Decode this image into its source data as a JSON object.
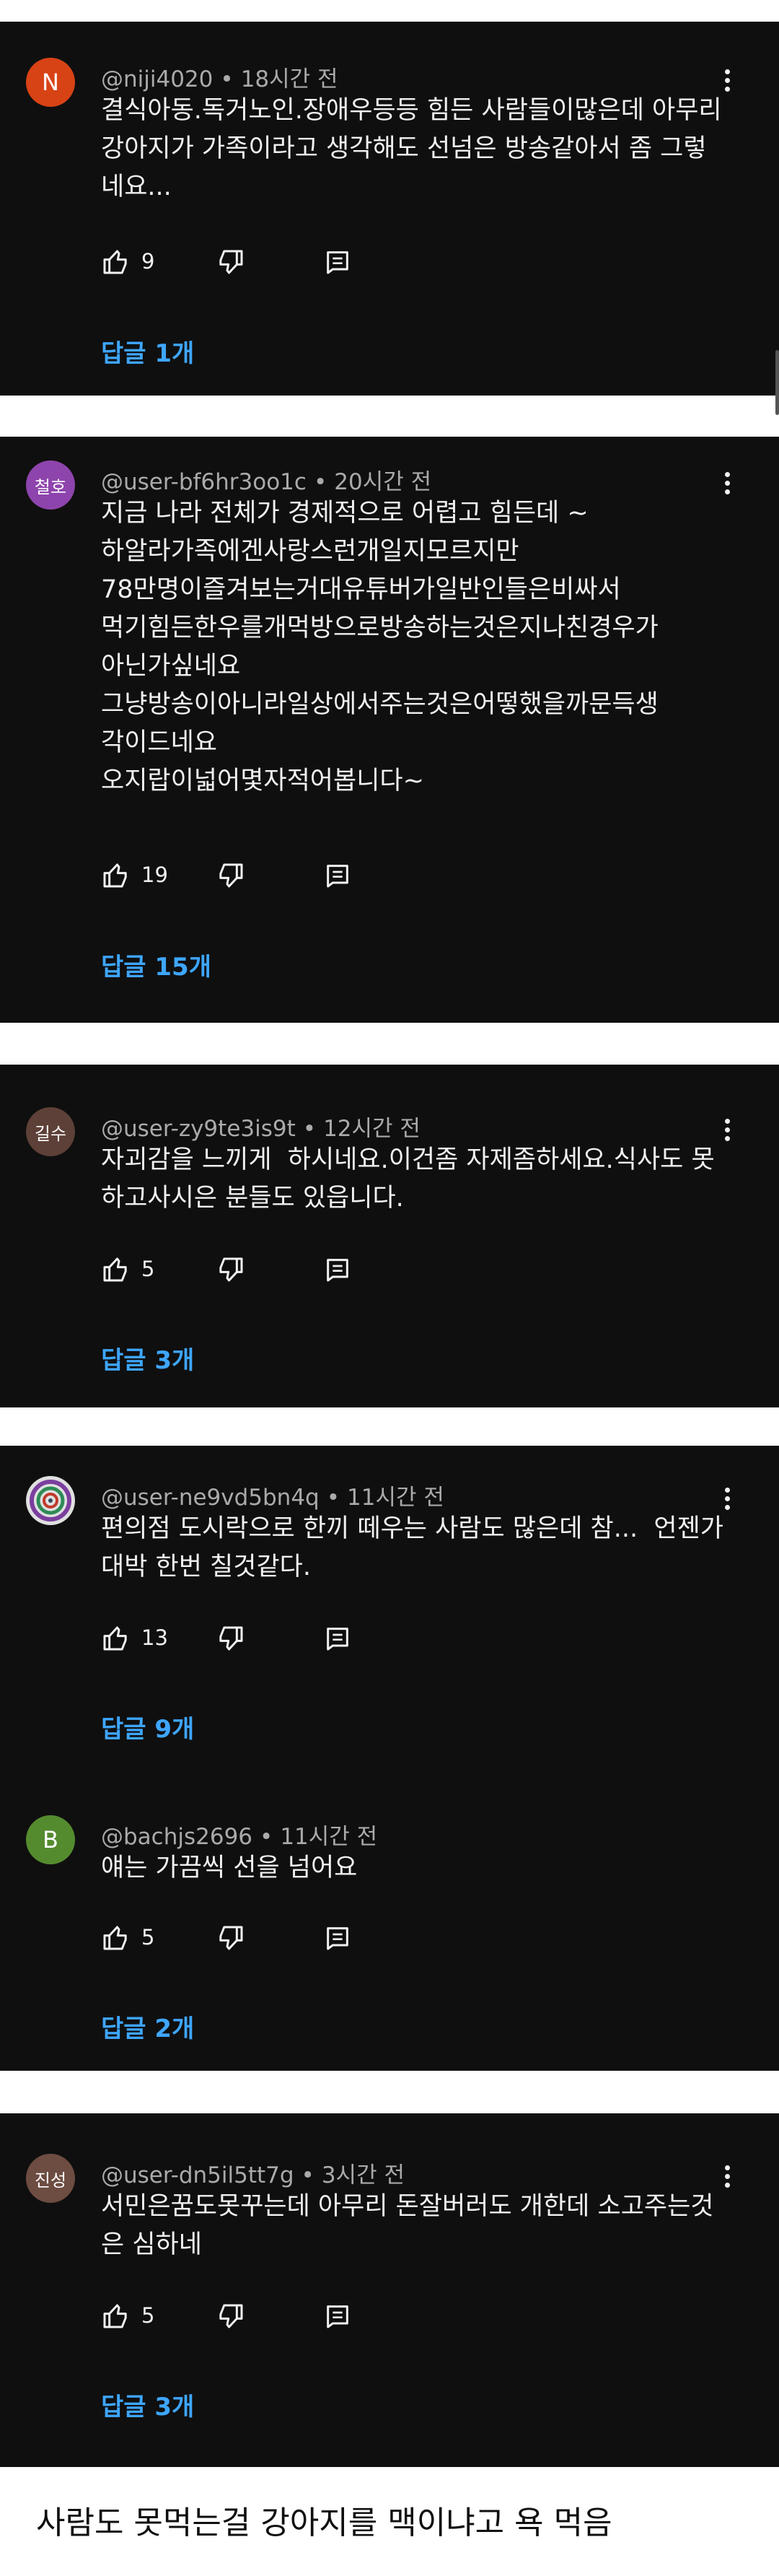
{
  "comments": [
    {
      "avatar_letter": "N",
      "avatar_color": "#d84315",
      "handle": "@niji4020",
      "time": "18시간 전",
      "text": "결식아동.독거노인.장애우등등 힘든 사람들이많은데 아무리 강아지가 가족이라고 생각해도 선넘은 방송같아서 좀 그렇네요...",
      "likes": "9",
      "replies": "답글 1개"
    },
    {
      "avatar_letter": "철호",
      "avatar_color": "#8e44ad",
      "handle": "@user-bf6hr3oo1c",
      "time": "20시간 전",
      "text": "지금 나라 전체가 경제적으로 어렵고 힘든데 ~\n하알라가족에겐사랑스런개일지모르지만\n78만명이즐겨보는거대유튜버가일반인들은비싸서\n먹기힘든한우를개먹방으로방송하는것은지나친경우가\n아닌가싶네요\n그냥방송이아니라일상에서주는것은어떻했을까문득생\n각이드네요\n오지랍이넓어몇자적어봅니다~",
      "likes": "19",
      "replies": "답글 15개"
    },
    {
      "avatar_letter": "길수",
      "avatar_color": "#5d4037",
      "handle": "@user-zy9te3is9t",
      "time": "12시간 전",
      "text": "자괴감을 느끼게  하시네요.이건좀 자제좀하세요.식사도 못하고사시은 분들도 있읍니다.",
      "likes": "5",
      "replies": "답글 3개"
    },
    {
      "avatar_letter": "",
      "avatar_color": "#e0e0e0",
      "handle": "@user-ne9vd5bn4q",
      "time": "11시간 전",
      "text": "편의점 도시락으로 한끼 떼우는 사람도 많은데 참...  언젠가 대박 한번 칠것같다.",
      "likes": "13",
      "replies": "답글 9개"
    },
    {
      "avatar_letter": "B",
      "avatar_color": "#558b2f",
      "handle": "@bachjs2696",
      "time": "11시간 전",
      "text": "얘는 가끔씩 선을 넘어요",
      "likes": "5",
      "replies": "답글 2개"
    },
    {
      "avatar_letter": "진성",
      "avatar_color": "#6d4c41",
      "handle": "@user-dn5il5tt7g",
      "time": "3시간 전",
      "text": "서민은꿈도못꾸는데 아무리 돈잘버러도 개한데 소고주는것은 심하네",
      "likes": "5",
      "replies": "답글 3개"
    }
  ],
  "separator": "•",
  "caption": "사람도 못먹는걸 강아지를 맥이냐고 욕 먹음",
  "colors": {
    "background": "#0f0f0f",
    "link": "#3ea6ff",
    "meta": "#aaaaaa",
    "text": "#f1f1f1"
  },
  "icons": {
    "like": "thumbs-up-icon",
    "dislike": "thumbs-down-icon",
    "reply": "comment-icon",
    "menu": "more-vert-icon"
  }
}
